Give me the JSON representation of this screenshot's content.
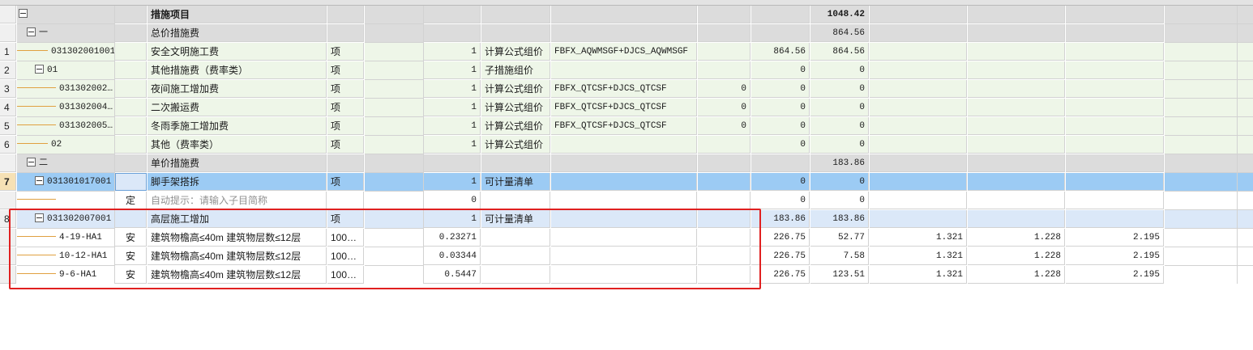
{
  "rows": [
    {
      "num": "",
      "code": "",
      "type": "",
      "name": "措施项目",
      "unit": "",
      "qty": "",
      "method": "",
      "formula": "",
      "rate": "",
      "price": "",
      "total": "1048.42",
      "c1": "",
      "c2": "",
      "c3": ""
    },
    {
      "num": "",
      "code": "一",
      "type": "",
      "name": "总价措施费",
      "unit": "",
      "qty": "",
      "method": "",
      "formula": "",
      "rate": "",
      "price": "",
      "total": "864.56",
      "c1": "",
      "c2": "",
      "c3": ""
    },
    {
      "num": "1",
      "code": "031302001001",
      "type": "",
      "name": "安全文明施工费",
      "unit": "项",
      "qty": "1",
      "method": "计算公式组价",
      "formula": "FBFX_AQWMSGF+DJCS_AQWMSGF",
      "rate": "",
      "price": "864.56",
      "total": "864.56",
      "c1": "",
      "c2": "",
      "c3": ""
    },
    {
      "num": "2",
      "code": "01",
      "type": "",
      "name": "其他措施费（费率类）",
      "unit": "项",
      "qty": "1",
      "method": "子措施组价",
      "formula": "",
      "rate": "",
      "price": "0",
      "total": "0",
      "c1": "",
      "c2": "",
      "c3": ""
    },
    {
      "num": "3",
      "code": "031302002…",
      "type": "",
      "name": "夜间施工增加费",
      "unit": "项",
      "qty": "1",
      "method": "计算公式组价",
      "formula": "FBFX_QTCSF+DJCS_QTCSF",
      "rate": "0",
      "price": "0",
      "total": "0",
      "c1": "",
      "c2": "",
      "c3": ""
    },
    {
      "num": "4",
      "code": "031302004…",
      "type": "",
      "name": "二次搬运费",
      "unit": "项",
      "qty": "1",
      "method": "计算公式组价",
      "formula": "FBFX_QTCSF+DJCS_QTCSF",
      "rate": "0",
      "price": "0",
      "total": "0",
      "c1": "",
      "c2": "",
      "c3": ""
    },
    {
      "num": "5",
      "code": "031302005…",
      "type": "",
      "name": "冬雨季施工增加费",
      "unit": "项",
      "qty": "1",
      "method": "计算公式组价",
      "formula": "FBFX_QTCSF+DJCS_QTCSF",
      "rate": "0",
      "price": "0",
      "total": "0",
      "c1": "",
      "c2": "",
      "c3": ""
    },
    {
      "num": "6",
      "code": "02",
      "type": "",
      "name": "其他（费率类）",
      "unit": "项",
      "qty": "1",
      "method": "计算公式组价",
      "formula": "",
      "rate": "",
      "price": "0",
      "total": "0",
      "c1": "",
      "c2": "",
      "c3": ""
    },
    {
      "num": "",
      "code": "二",
      "type": "",
      "name": "单价措施费",
      "unit": "",
      "qty": "",
      "method": "",
      "formula": "",
      "rate": "",
      "price": "",
      "total": "183.86",
      "c1": "",
      "c2": "",
      "c3": ""
    },
    {
      "num": "7",
      "code": "031301017001",
      "type": "",
      "name": "脚手架搭拆",
      "unit": "项",
      "qty": "1",
      "method": "可计量清单",
      "formula": "",
      "rate": "",
      "price": "0",
      "total": "0",
      "c1": "",
      "c2": "",
      "c3": ""
    },
    {
      "num": "",
      "code": "",
      "type": "定",
      "name": "自动提示：请输入子目简称",
      "unit": "",
      "qty": "0",
      "method": "",
      "formula": "",
      "rate": "",
      "price": "0",
      "total": "0",
      "c1": "",
      "c2": "",
      "c3": ""
    },
    {
      "num": "8",
      "code": "031302007001",
      "type": "",
      "name": "高层施工增加",
      "unit": "项",
      "qty": "1",
      "method": "可计量清单",
      "formula": "",
      "rate": "",
      "price": "183.86",
      "total": "183.86",
      "c1": "",
      "c2": "",
      "c3": ""
    },
    {
      "num": "",
      "code": "4-19-HA1",
      "type": "安",
      "name": "建筑物檐高≤40m 建筑物层数≤12层",
      "unit": "100…",
      "qty": "0.23271",
      "method": "",
      "formula": "",
      "rate": "",
      "price": "226.75",
      "total": "52.77",
      "c1": "1.321",
      "c2": "1.228",
      "c3": "2.195"
    },
    {
      "num": "",
      "code": "10-12-HA1",
      "type": "安",
      "name": "建筑物檐高≤40m 建筑物层数≤12层",
      "unit": "100…",
      "qty": "0.03344",
      "method": "",
      "formula": "",
      "rate": "",
      "price": "226.75",
      "total": "7.58",
      "c1": "1.321",
      "c2": "1.228",
      "c3": "2.195"
    },
    {
      "num": "",
      "code": "9-6-HA1",
      "type": "安",
      "name": "建筑物檐高≤40m 建筑物层数≤12层",
      "unit": "100…",
      "qty": "0.5447",
      "method": "",
      "formula": "",
      "rate": "",
      "price": "226.75",
      "total": "123.51",
      "c1": "1.321",
      "c2": "1.228",
      "c3": "2.195"
    }
  ]
}
